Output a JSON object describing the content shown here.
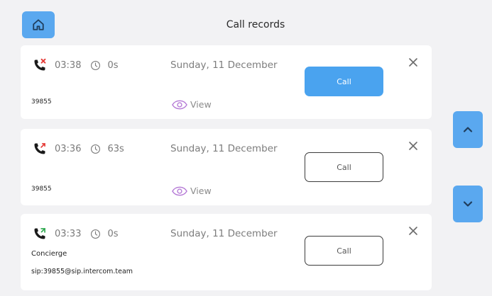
{
  "header": {
    "title": "Call records"
  },
  "records": [
    {
      "type": "missed",
      "time": "03:38",
      "duration": "0s",
      "date": "Sunday, 11 December",
      "number": "39855",
      "view_label": "View",
      "call_label": "Call",
      "call_style": "primary"
    },
    {
      "type": "outgoing",
      "time": "03:36",
      "duration": "63s",
      "date": "Sunday, 11 December",
      "number": "39855",
      "view_label": "View",
      "call_label": "Call",
      "call_style": "outline"
    },
    {
      "type": "incoming",
      "time": "03:33",
      "duration": "0s",
      "date": "Sunday, 11 December",
      "name": "Concierge",
      "sip": "sip:39855@sip.intercom.team",
      "call_label": "Call",
      "call_style": "outline"
    }
  ],
  "colors": {
    "accent": "#5aa8ef",
    "primary_button": "#4aa3ef",
    "missed_red": "#e53935",
    "view_purple": "#b57ad6",
    "background": "#f2f2f4"
  },
  "icons": {
    "home": "home-icon",
    "missed": "missed-call-icon",
    "outgoing": "outgoing-call-icon",
    "incoming": "incoming-call-icon",
    "clock": "clock-icon",
    "eye": "eye-icon",
    "close": "close-icon",
    "up": "chevron-up-icon",
    "down": "chevron-down-icon"
  }
}
